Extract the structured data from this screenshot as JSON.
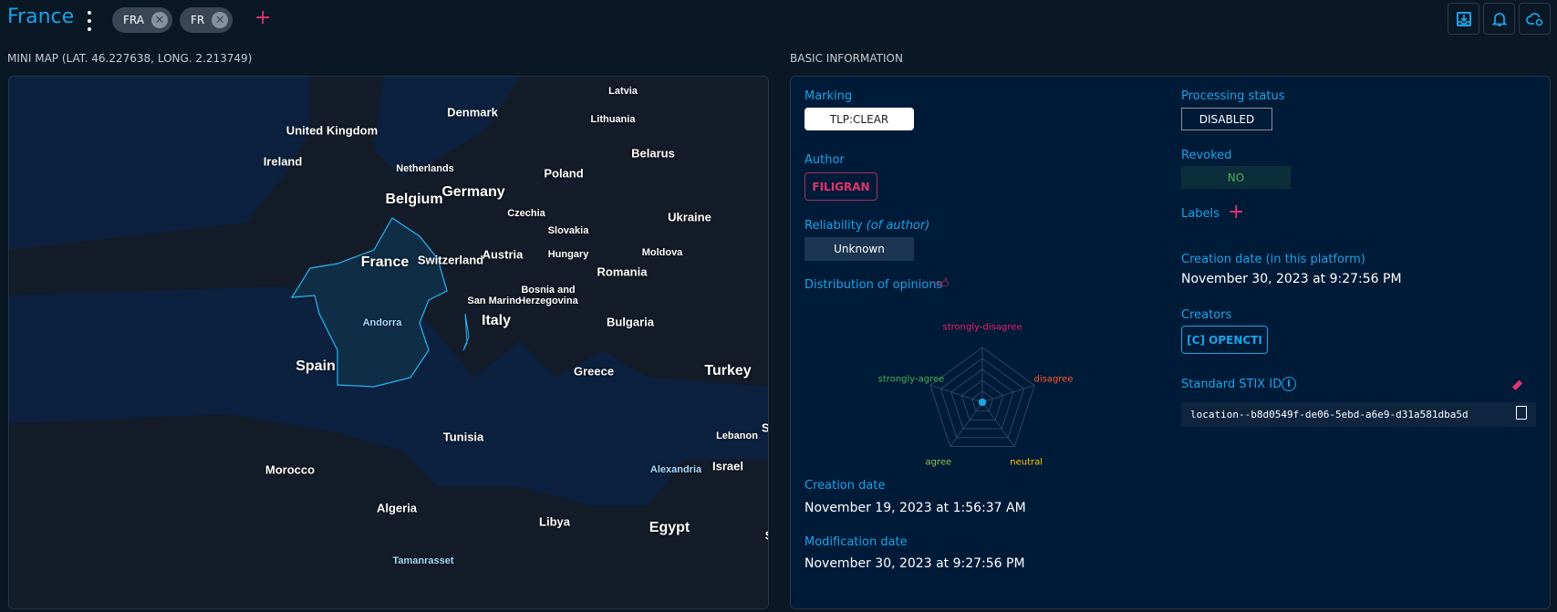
{
  "header": {
    "title": "France",
    "aliases": [
      "FRA",
      "FR"
    ],
    "add_alias_icon": "plus-icon",
    "actions": [
      "download-icon",
      "bell-icon",
      "cloud-refresh-icon"
    ]
  },
  "minimap": {
    "section_title": "MINI MAP (LAT. 46.227638, LONG. 2.213749)",
    "labels": [
      "United Kingdom",
      "Ireland",
      "Denmark",
      "Latvia",
      "Lithuania",
      "Belarus",
      "Netherlands",
      "Germany",
      "Poland",
      "Belgium",
      "Czechia",
      "Slovakia",
      "Ukraine",
      "France",
      "Switzerland",
      "Austria",
      "Hungary",
      "Moldova",
      "Romania",
      "Bosnia and Herzegovina",
      "San Marino",
      "Italy",
      "Bulgaria",
      "Andorra",
      "Spain",
      "Greece",
      "Turkey",
      "Tunisia",
      "Lebanon",
      "Sy",
      "Morocco",
      "Israel",
      "Alexandria",
      "Algeria",
      "Libya",
      "Egypt",
      "Tamanrasset",
      "S"
    ],
    "highlight_color": "#29b6f6"
  },
  "basic": {
    "section_title": "BASIC INFORMATION",
    "marking_label": "Marking",
    "marking": "TLP:CLEAR",
    "author_label": "Author",
    "author": "FILIGRAN",
    "reliability_label": "Reliability",
    "reliability_note": "(of author)",
    "reliability": "Unknown",
    "opinions_label": "Distribution of opinions",
    "opinions": {
      "axes": [
        "strongly-disagree",
        "disagree",
        "neutral",
        "agree",
        "strongly-agree"
      ],
      "colors": [
        "#e91e63",
        "#ff5722",
        "#ffc107",
        "#8bc34a",
        "#4caf50"
      ],
      "values": [
        0,
        0,
        0,
        0,
        0
      ]
    },
    "creation_label": "Creation date",
    "creation": "November 19, 2023 at 1:56:37 AM",
    "modification_label": "Modification date",
    "modification": "November 30, 2023 at 9:27:56 PM",
    "processing_label": "Processing status",
    "processing": "DISABLED",
    "revoked_label": "Revoked",
    "revoked": "NO",
    "labels_label": "Labels",
    "platform_creation_label": "Creation date (in this platform)",
    "platform_creation": "November 30, 2023 at 9:27:56 PM",
    "creators_label": "Creators",
    "creator": "[C] OPENCTI",
    "stix_label": "Standard STIX ID",
    "stix_id": "location--b8d0549f-de06-5ebd-a6e9-d31a581dba5d"
  }
}
